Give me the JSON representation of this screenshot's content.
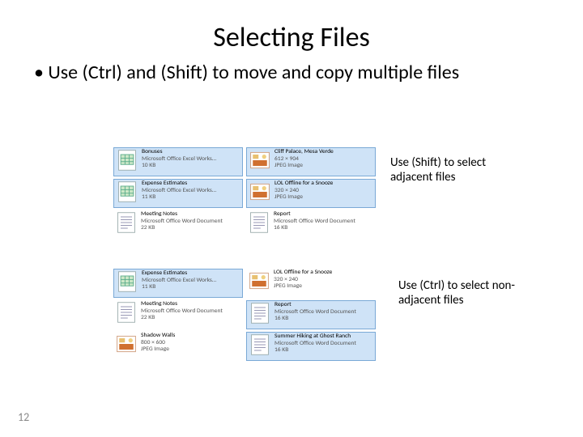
{
  "title": "Selecting Files",
  "bullet_prefix": "Use ",
  "bullet_ctrl": "(Ctrl)",
  "bullet_mid": " and ",
  "bullet_shift": "(Shift)",
  "bullet_rest": " to move and copy multiple files",
  "annot_top_pre": "Use ",
  "annot_top_key": "(Shift)",
  "annot_top_post": " to select adjacent files",
  "annot_bot_pre": "Use ",
  "annot_bot_key": "(Ctrl)",
  "annot_bot_post": " to select non-adjacent files",
  "page_number": "12",
  "top_files": [
    {
      "name": "Bonuses",
      "type": "Microsoft Office Excel Works…",
      "size": "10 KB",
      "icon": "excel",
      "sel": true
    },
    {
      "name": "Cliff Palace, Mesa Verde",
      "type": "612 × 904",
      "size": "JPEG Image",
      "icon": "jpeg",
      "sel": true
    },
    {
      "name": "Expense Estimates",
      "type": "Microsoft Office Excel Works…",
      "size": "11 KB",
      "icon": "excel",
      "sel": true
    },
    {
      "name": "LOL Offline for a Snooze",
      "type": "320 × 240",
      "size": "JPEG Image",
      "icon": "jpeg",
      "sel": true
    },
    {
      "name": "Meeting Notes",
      "type": "Microsoft Office Word Document",
      "size": "22 KB",
      "icon": "word",
      "sel": false
    },
    {
      "name": "Report",
      "type": "Microsoft Office Word Document",
      "size": "16 KB",
      "icon": "word",
      "sel": false
    }
  ],
  "bot_files": [
    {
      "name": "Expense Estimates",
      "type": "Microsoft Office Excel Works…",
      "size": "11 KB",
      "icon": "excel",
      "sel": true
    },
    {
      "name": "LOL Offline for a Snooze",
      "type": "320 × 240",
      "size": "JPEG Image",
      "icon": "jpeg",
      "sel": false
    },
    {
      "name": "Meeting Notes",
      "type": "Microsoft Office Word Document",
      "size": "22 KB",
      "icon": "word",
      "sel": false
    },
    {
      "name": "Report",
      "type": "Microsoft Office Word Document",
      "size": "16 KB",
      "icon": "word",
      "sel": true
    },
    {
      "name": "Shadow Walls",
      "type": "800 × 600",
      "size": "JPEG Image",
      "icon": "jpeg",
      "sel": false
    },
    {
      "name": "Summer Hiking at Ghost Ranch",
      "type": "Microsoft Office Word Document",
      "size": "16 KB",
      "icon": "word",
      "sel": true
    }
  ]
}
